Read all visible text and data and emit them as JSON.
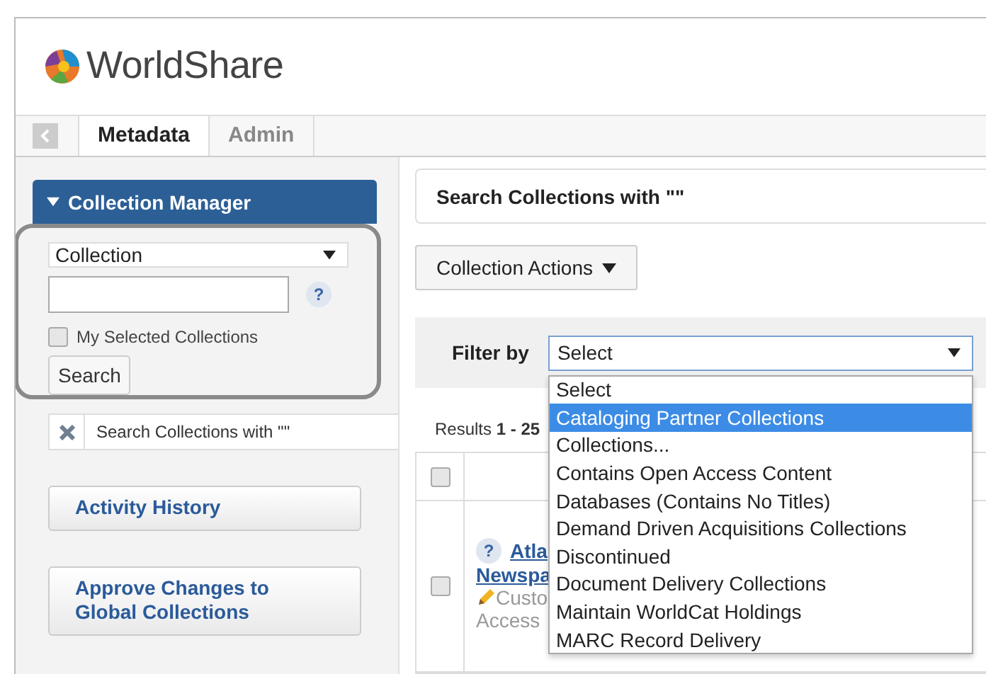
{
  "header": {
    "logo_text": "WorldShare"
  },
  "nav": {
    "tabs": [
      {
        "label": "Metadata",
        "selected": true
      },
      {
        "label": "Admin",
        "selected": false
      }
    ]
  },
  "sidebar": {
    "panel_title": "Collection Manager",
    "expanded": true,
    "search_type": "Collection",
    "help": "?",
    "checkbox": {
      "label": "My Selected Collections",
      "checked": false
    },
    "search_button": "Search",
    "recent_search": "Search Collections with \"\"",
    "links": [
      "Activity History",
      "Approve Changes to Global Collections"
    ]
  },
  "main": {
    "title": "Search Collections with \"\"",
    "actions_button": "Collection Actions",
    "filter": {
      "label": "Filter by",
      "value": "Select",
      "open": true,
      "options": [
        {
          "label": "Select",
          "highlighted": false
        },
        {
          "label": "Cataloging Partner Collections",
          "highlighted": true
        },
        {
          "label": "Collections...",
          "highlighted": false
        },
        {
          "label": "Contains Open Access Content",
          "highlighted": false
        },
        {
          "label": "Databases (Contains No Titles)",
          "highlighted": false
        },
        {
          "label": "Demand Driven Acquisitions Collections",
          "highlighted": false
        },
        {
          "label": "Discontinued",
          "highlighted": false
        },
        {
          "label": "Document Delivery Collections",
          "highlighted": false
        },
        {
          "label": "Maintain WorldCat Holdings",
          "highlighted": false
        },
        {
          "label": "MARC Record Delivery",
          "highlighted": false
        }
      ]
    },
    "results": "Results **1 - 25**",
    "table": {
      "header_checked": false,
      "rows": [
        {
          "checked": false,
          "help": "?",
          "title_lines": [
            "Atla",
            "Newspa"
          ],
          "note": "Custo",
          "note_2": "Access"
        }
      ]
    }
  }
}
